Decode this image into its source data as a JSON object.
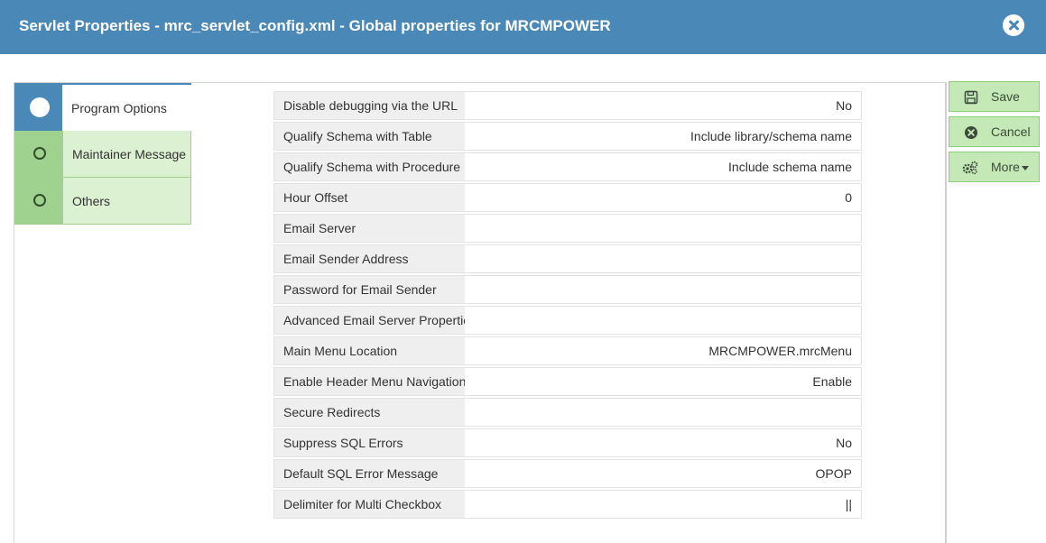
{
  "window": {
    "title": "Servlet Properties - mrc_servlet_config.xml - Global properties for MRCMPOWER",
    "close_icon": "times-circle-icon"
  },
  "tabs": [
    {
      "label": "Program Options",
      "active": true,
      "icon": "filled-circle-icon"
    },
    {
      "label": "Maintainer Message",
      "active": false,
      "icon": "circle-outline-icon"
    },
    {
      "label": "Others",
      "active": false,
      "icon": "circle-outline-icon"
    }
  ],
  "properties": [
    {
      "key": "Disable debugging via the URL",
      "value": "No"
    },
    {
      "key": "Qualify Schema with Table",
      "value": "Include library/schema name"
    },
    {
      "key": "Qualify Schema with Procedure",
      "value": "Include schema name"
    },
    {
      "key": "Hour Offset",
      "value": "0"
    },
    {
      "key": "Email Server",
      "value": ""
    },
    {
      "key": "Email Sender Address",
      "value": ""
    },
    {
      "key": "Password for Email Sender",
      "value": ""
    },
    {
      "key": "Advanced Email Server Properties",
      "value": ""
    },
    {
      "key": "Main Menu Location",
      "value": "MRCMPOWER.mrcMenu"
    },
    {
      "key": "Enable Header Menu Navigation",
      "value": "Enable"
    },
    {
      "key": "Secure Redirects",
      "value": ""
    },
    {
      "key": "Suppress SQL Errors",
      "value": "No"
    },
    {
      "key": "Default SQL Error Message",
      "value": "OPOP"
    },
    {
      "key": "Delimiter for Multi Checkbox",
      "value": "||"
    }
  ],
  "actions": {
    "save_label": "Save",
    "cancel_label": "Cancel",
    "more_label": "More"
  },
  "colors": {
    "titlebar": "#4a88b7",
    "button_bg": "#c4e8b6",
    "tab_bg": "#dcf0d2"
  }
}
